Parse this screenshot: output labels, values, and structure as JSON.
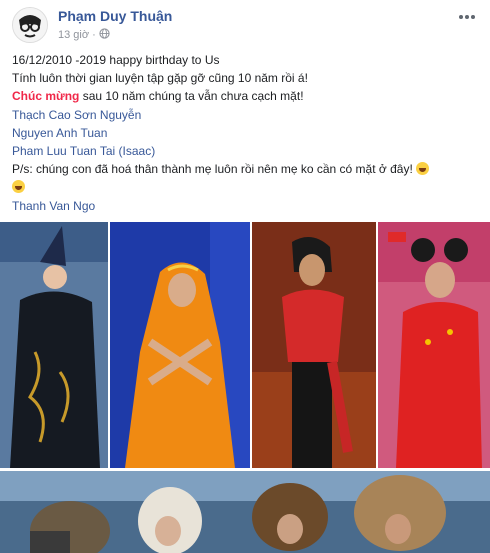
{
  "post": {
    "author": "Phạm Duy Thuận",
    "time": "13 giờ",
    "separator": "·",
    "privacy_icon": "globe-icon",
    "more_icon": "more-options-icon"
  },
  "content": {
    "line1": "16/12/2010 -2019 happy birthday to Us",
    "line2": "Tính luôn thời gian luyện tập gặp gỡ cũng 10 năm rồi á!",
    "line3_highlight": "Chúc mừng",
    "line3_rest": " sau 10 năm chúng ta vẫn chưa cạch mặt!",
    "tags": [
      "Thạch Cao Sơn Nguyễn",
      "Nguyen Anh Tuan",
      "Pham Luu Tuan Tai (Isaac)"
    ],
    "ps": "P/s: chúng con đã hoá thân thành mẹ luôn rồi nên mẹ ko cần có mặt ở đây!",
    "last_tag": "Thanh Van Ngo"
  },
  "colors": {
    "author": "#385898",
    "highlight": "#f02849",
    "meta": "#90949c"
  }
}
